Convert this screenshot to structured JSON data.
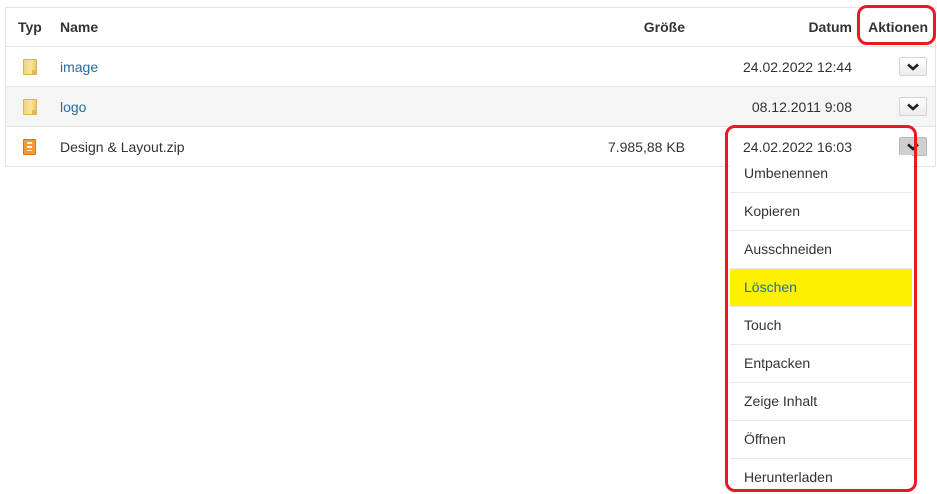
{
  "table": {
    "headers": {
      "typ": "Typ",
      "name": "Name",
      "size": "Größe",
      "date": "Datum",
      "actions": "Aktionen"
    },
    "rows": [
      {
        "type_icon": "folder-icon",
        "name": "image",
        "size": "",
        "date": "24.02.2022 12:44"
      },
      {
        "type_icon": "folder-icon",
        "name": "logo",
        "size": "",
        "date": "08.12.2011 9:08"
      },
      {
        "type_icon": "zip-file-icon",
        "name": "Design & Layout.zip",
        "size": "7.985,88 KB",
        "date": "24.02.2022 16:03"
      }
    ]
  },
  "action_menu": {
    "items": [
      "Umbenennen",
      "Kopieren",
      "Ausschneiden",
      "Löschen",
      "Touch",
      "Entpacken",
      "Zeige Inhalt",
      "Öffnen",
      "Herunterladen"
    ],
    "selected": "Löschen"
  },
  "colors": {
    "highlight_border": "#e31b23",
    "selected_item": "#fff200",
    "link": "#2a6aa0"
  }
}
